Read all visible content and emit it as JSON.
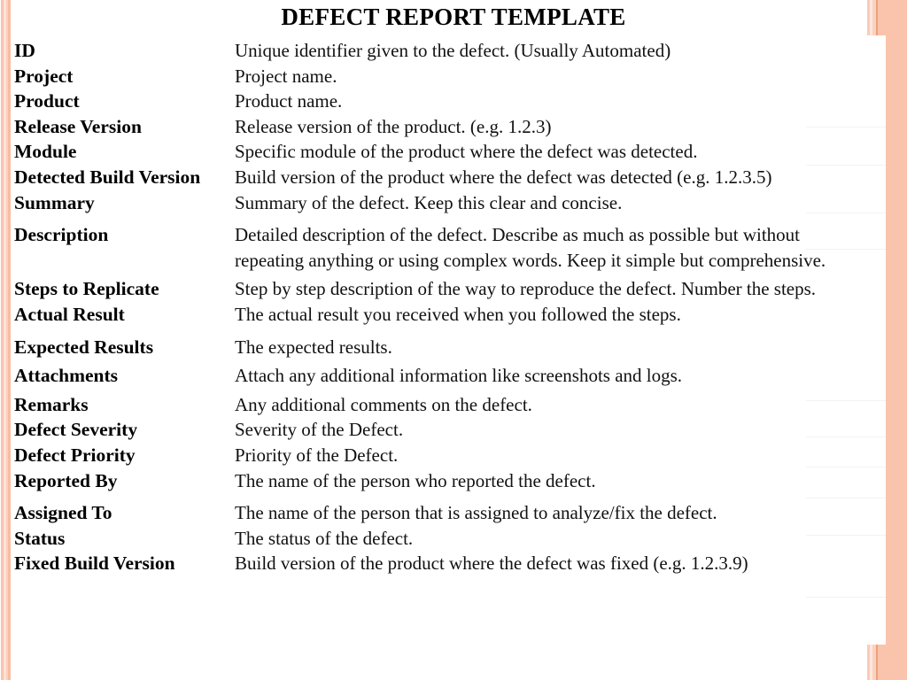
{
  "document": {
    "title": "DEFECT REPORT TEMPLATE"
  },
  "theme": {
    "accent_peach": "#fac4ac",
    "accent_peach_dark": "#eda07e",
    "accent_peach_light": "#fde3d6",
    "page_background": "#ffffff",
    "text_color": "#000000"
  },
  "fields": [
    {
      "label": "ID",
      "description": "Unique identifier given to the defect. (Usually Automated)"
    },
    {
      "label": "Project",
      "description": "Project name."
    },
    {
      "label": "Product",
      "description": "Product name."
    },
    {
      "label": "Release Version",
      "description": "Release version of the product. (e.g. 1.2.3)"
    },
    {
      "label": "Module",
      "description": "Specific module of the product where the defect was detected."
    },
    {
      "label": "Detected Build Version",
      "description": "Build version of the product where the defect was detected (e.g. 1.2.3.5)"
    },
    {
      "label": "Summary",
      "description": "Summary of the defect. Keep this clear and concise."
    },
    {
      "label": "Description",
      "description": "Detailed description of the defect. Describe as much as possible but without repeating anything or using complex words. Keep it simple but comprehensive."
    },
    {
      "label": "Steps to Replicate",
      "description": "Step by step description of the way to reproduce the defect. Number the steps."
    },
    {
      "label": "Actual Result",
      "description": "The actual result you received when you followed the steps."
    },
    {
      "label": "Expected Results",
      "description": "The expected results."
    },
    {
      "label": "Attachments",
      "description": "Attach any additional information like screenshots and logs."
    },
    {
      "label": "Remarks",
      "description": "Any additional comments on the defect."
    },
    {
      "label": "Defect Severity",
      "description": "Severity of the Defect."
    },
    {
      "label": "Defect Priority",
      "description": "Priority of the Defect."
    },
    {
      "label": "Reported By",
      "description": "The name of the person who reported the defect."
    },
    {
      "label": "Assigned To",
      "description": "The name of the person that is assigned to analyze/fix the defect."
    },
    {
      "label": "Status",
      "description": "The status of the defect."
    },
    {
      "label": "Fixed Build Version",
      "description": "Build version of the product where the defect was fixed (e.g. 1.2.3.9)"
    }
  ]
}
